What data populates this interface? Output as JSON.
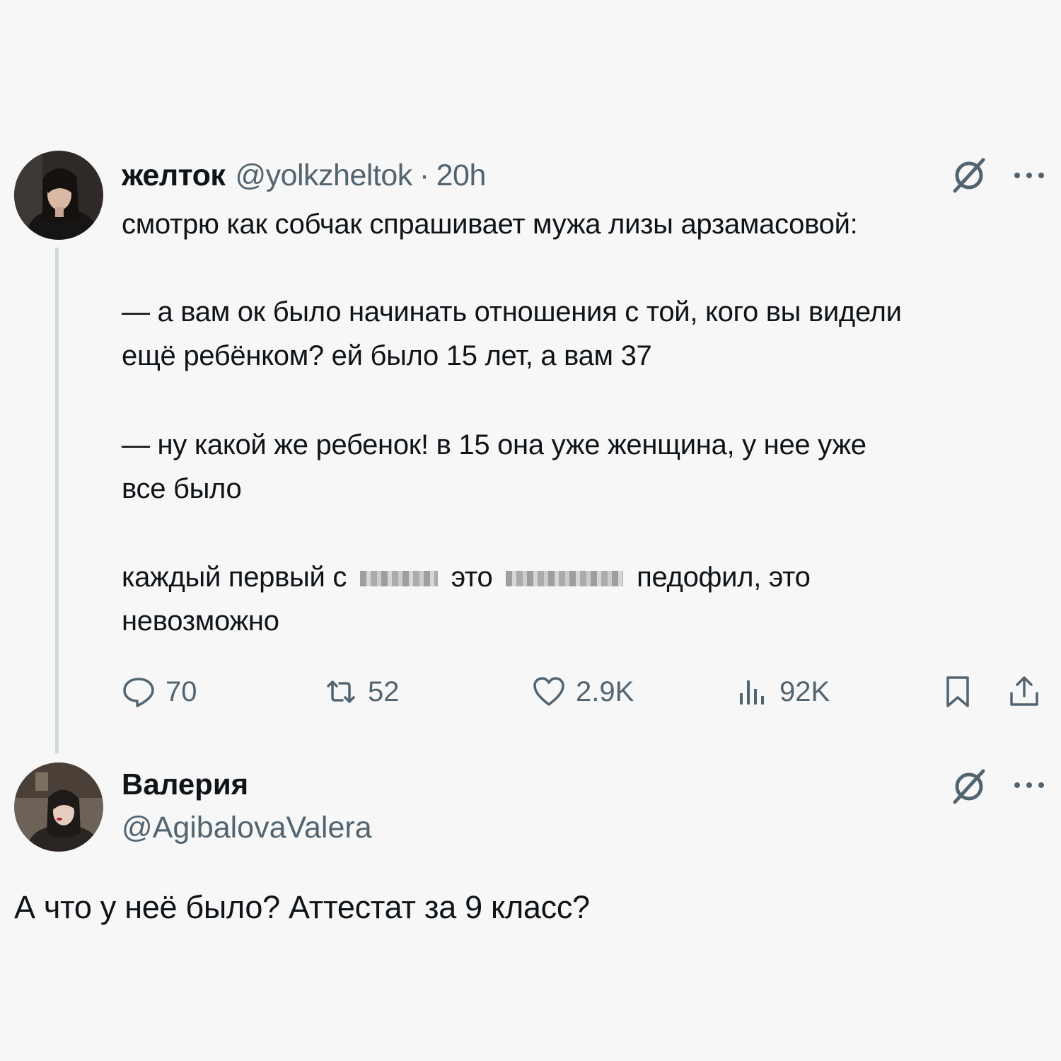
{
  "tweet": {
    "author_name": "желток",
    "author_handle": "@yolkzheltok",
    "separator": "·",
    "time": "20h",
    "lines": {
      "l1": "смотрю как собчак спрашивает мужа лизы арзамасовой:",
      "l2": "— а вам ок было начинать отношения с той, кого вы видели",
      "l3": "ещё ребёнком? ей было 15 лет, а вам 37",
      "l4": "— ну какой же ребенок! в 15 она уже женщина, у нее уже",
      "l5": "все было",
      "l6a": "каждый первый с",
      "l6b": "это",
      "l6c": "педофил, это",
      "l7": "невозможно"
    },
    "stats": {
      "replies": "70",
      "retweets": "52",
      "likes": "2.9K",
      "views": "92K"
    },
    "icons": [
      "grok-icon",
      "more-icon",
      "reply-icon",
      "retweet-icon",
      "like-icon",
      "views-icon",
      "bookmark-icon",
      "share-icon"
    ]
  },
  "reply": {
    "author_name": "Валерия",
    "author_handle": "@AgibalovaValera",
    "text": "А что у неё было? Аттестат за 9 класс?"
  },
  "colors": {
    "background": "#f7f7f7",
    "text": "#0f1419",
    "secondary": "#536471",
    "thread_line": "#cfd9de"
  }
}
